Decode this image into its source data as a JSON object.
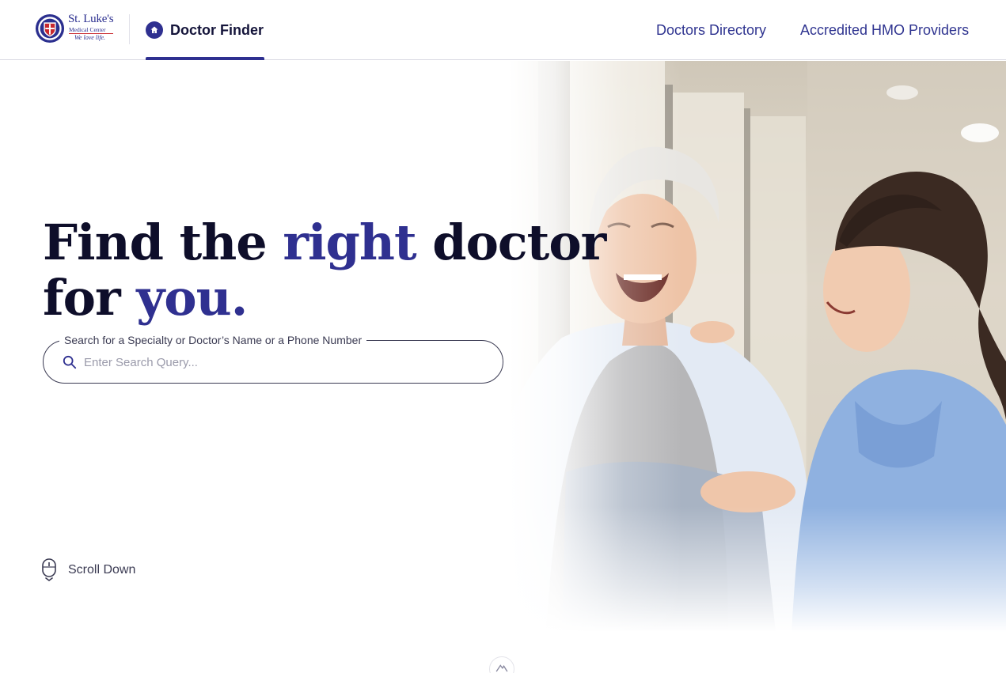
{
  "brand": {
    "name": "St. Luke's",
    "subtitle": "Medical Center",
    "tagline": "We love life.",
    "colors": {
      "primary": "#2f3090",
      "accent_red": "#c8282e"
    }
  },
  "header": {
    "active_tab": {
      "label": "Doctor Finder",
      "icon": "home-icon"
    },
    "nav": [
      {
        "label": "Doctors Directory"
      },
      {
        "label": "Accredited HMO Providers"
      }
    ]
  },
  "hero": {
    "headline": {
      "line1_pre": "Find the ",
      "line1_accent": "right",
      "line1_post": " doctor",
      "line2_pre": "for ",
      "line2_accent": "you."
    },
    "search": {
      "label": "Search for a Specialty or Doctor’s Name or a Phone Number",
      "placeholder": "Enter Search Query...",
      "value": "",
      "icon": "search-icon"
    },
    "scroll": {
      "label": "Scroll Down",
      "icon": "mouse-icon"
    }
  }
}
